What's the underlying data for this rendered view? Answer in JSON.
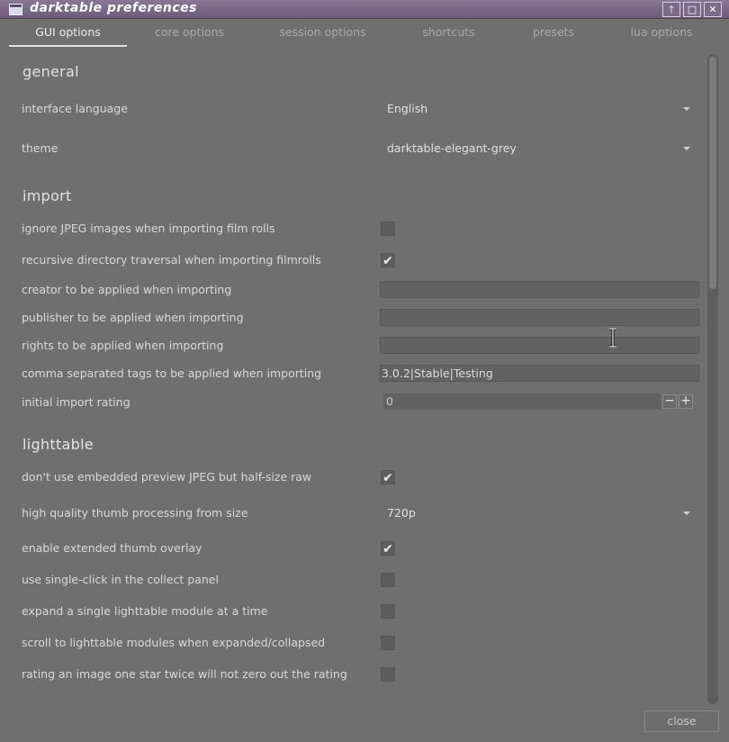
{
  "window": {
    "title": "darktable preferences",
    "controls": [
      "up-icon",
      "maximize-icon",
      "close-icon"
    ]
  },
  "tabs": [
    {
      "label": "GUI options",
      "active": true
    },
    {
      "label": "core options",
      "active": false
    },
    {
      "label": "session options",
      "active": false
    },
    {
      "label": "shortcuts",
      "active": false
    },
    {
      "label": "presets",
      "active": false
    },
    {
      "label": "lua options",
      "active": false
    }
  ],
  "sections": {
    "general": {
      "heading": "general",
      "interface_language": {
        "label": "interface language",
        "value": "English"
      },
      "theme": {
        "label": "theme",
        "value": "darktable-elegant-grey"
      }
    },
    "import": {
      "heading": "import",
      "ignore_jpeg": {
        "label": "ignore JPEG images when importing film rolls",
        "checked": false
      },
      "recursive": {
        "label": "recursive directory traversal when importing filmrolls",
        "checked": true
      },
      "creator": {
        "label": "creator to be applied when importing",
        "value": ""
      },
      "publisher": {
        "label": "publisher to be applied when importing",
        "value": ""
      },
      "rights": {
        "label": "rights to be applied when importing",
        "value": ""
      },
      "tags": {
        "label": "comma separated tags to be applied when importing",
        "value": "3.0.2|Stable|Testing"
      },
      "rating": {
        "label": "initial import rating",
        "value": "0",
        "minus": "−",
        "plus": "+"
      }
    },
    "lighttable": {
      "heading": "lighttable",
      "no_embedded": {
        "label": "don't use embedded preview JPEG but half-size raw",
        "checked": true
      },
      "hq_thumb": {
        "label": "high quality thumb processing from size",
        "value": "720p"
      },
      "extended_overlay": {
        "label": "enable extended thumb overlay",
        "checked": true
      },
      "single_click": {
        "label": "use single-click in the collect panel",
        "checked": false
      },
      "expand_single": {
        "label": "expand a single lighttable module at a time",
        "checked": false
      },
      "scroll_modules": {
        "label": "scroll to lighttable modules when expanded/collapsed",
        "checked": false
      },
      "rating_twice": {
        "label": "rating an image one star twice will not zero out the rating",
        "checked": false
      }
    }
  },
  "footer": {
    "close_label": "close"
  },
  "colors": {
    "titlebar": "#7d6a8a",
    "background": "#6f6f6f"
  }
}
